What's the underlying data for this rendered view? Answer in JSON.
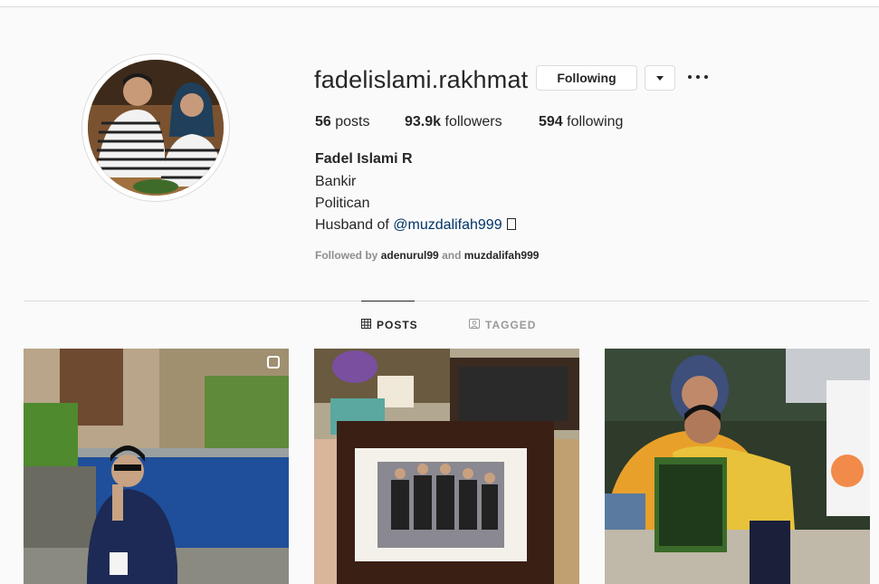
{
  "profile": {
    "username": "fadelislami.rakhmat",
    "following_button": "Following",
    "stats": {
      "posts_count": "56",
      "posts_label": "posts",
      "followers_count": "93.9k",
      "followers_label": "followers",
      "following_count": "594",
      "following_label": "following"
    },
    "bio": {
      "name": "Fadel Islami R",
      "line1": "Bankir",
      "line2": "Politican",
      "line3_prefix": "Husband of ",
      "line3_mention": "@muzdalifah999"
    },
    "followed_by": {
      "prefix": "Followed by",
      "user1": "adenurul99",
      "conjunction": "and",
      "user2": "muzdalifah999"
    }
  },
  "tabs": [
    {
      "label": "POSTS",
      "icon": "grid-icon",
      "active": true
    },
    {
      "label": "TAGGED",
      "icon": "tag-person-icon",
      "active": false
    }
  ],
  "posts": [
    {
      "type": "photo",
      "multiple": true
    },
    {
      "type": "photo",
      "multiple": false
    },
    {
      "type": "photo",
      "multiple": false
    }
  ],
  "colors": {
    "link": "#003569",
    "text": "#262626",
    "muted": "#8e8e8e",
    "border": "#dbdbdb"
  }
}
